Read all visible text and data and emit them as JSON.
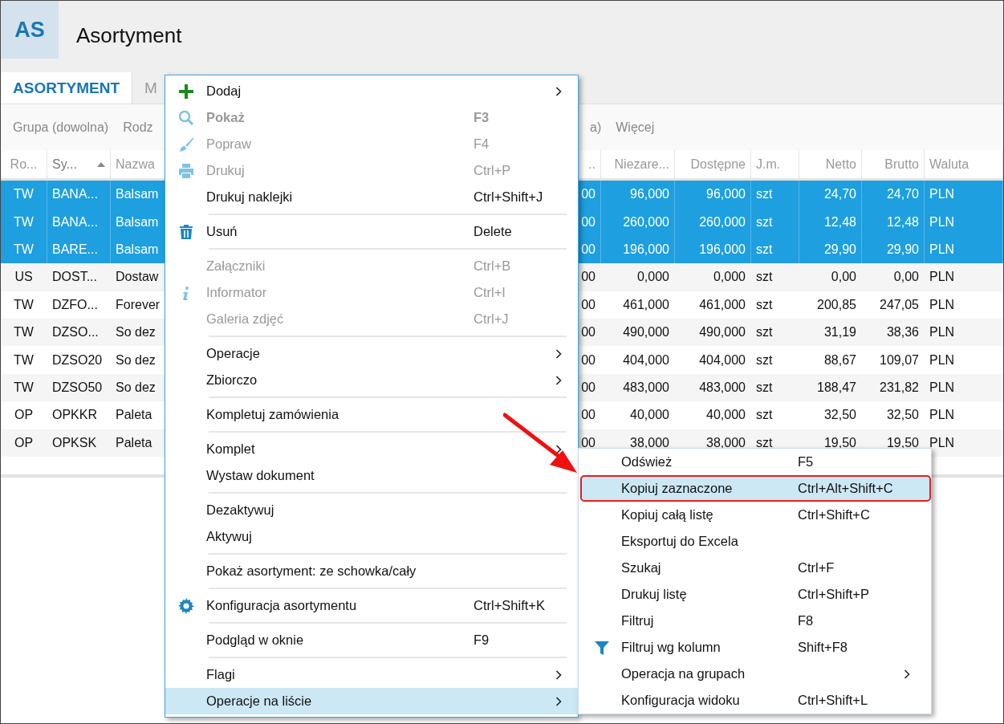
{
  "header": {
    "badge": "AS",
    "title": "Asortyment"
  },
  "tabs": [
    {
      "label": "ASORTYMENT",
      "selected": true
    },
    {
      "label": "M",
      "selected": false
    }
  ],
  "filters": {
    "left": [
      "Grupa (dowolna)",
      "Rodz"
    ],
    "right": [
      "a)",
      "Więcej"
    ]
  },
  "table": {
    "columns": [
      {
        "label": "Ro...",
        "sorted": false
      },
      {
        "label": "Sy...",
        "sorted": true
      },
      {
        "label": "Nazwa",
        "sorted": false
      },
      {
        "label": "..",
        "sorted": false
      },
      {
        "label": "Niezare...",
        "sorted": false
      },
      {
        "label": "Dostępne",
        "sorted": false
      },
      {
        "label": "J.m.",
        "sorted": false
      },
      {
        "label": "Netto",
        "sorted": false
      },
      {
        "label": "Brutto",
        "sorted": false
      },
      {
        "label": "Waluta",
        "sorted": false
      }
    ],
    "rows": [
      {
        "selected": true,
        "cells": [
          "TW",
          "BANA...",
          "Balsam",
          "00",
          "96,000",
          "96,000",
          "szt",
          "24,70",
          "24,70",
          "PLN"
        ]
      },
      {
        "selected": true,
        "cells": [
          "TW",
          "BANA...",
          "Balsam",
          "00",
          "260,000",
          "260,000",
          "szt",
          "12,48",
          "12,48",
          "PLN"
        ]
      },
      {
        "selected": true,
        "cells": [
          "TW",
          "BARE...",
          "Balsam",
          "00",
          "196,000",
          "196,000",
          "szt",
          "29,90",
          "29,90",
          "PLN"
        ]
      },
      {
        "selected": false,
        "cells": [
          "US",
          "DOST...",
          "Dostaw",
          "00",
          "0,000",
          "0,000",
          "szt",
          "0,00",
          "0,00",
          "PLN"
        ]
      },
      {
        "selected": false,
        "cells": [
          "TW",
          "DZFO...",
          "Forever",
          "00",
          "461,000",
          "461,000",
          "szt",
          "200,85",
          "247,05",
          "PLN"
        ]
      },
      {
        "selected": false,
        "cells": [
          "TW",
          "DZSO...",
          "So dez",
          "00",
          "490,000",
          "490,000",
          "szt",
          "31,19",
          "38,36",
          "PLN"
        ]
      },
      {
        "selected": false,
        "cells": [
          "TW",
          "DZSO20",
          "So dez",
          "00",
          "404,000",
          "404,000",
          "szt",
          "88,67",
          "109,07",
          "PLN"
        ]
      },
      {
        "selected": false,
        "cells": [
          "TW",
          "DZSO50",
          "So dez",
          "00",
          "483,000",
          "483,000",
          "szt",
          "188,47",
          "231,82",
          "PLN"
        ]
      },
      {
        "selected": false,
        "cells": [
          "OP",
          "OPKKR",
          "Paleta",
          "00",
          "40,000",
          "40,000",
          "szt",
          "32,50",
          "32,50",
          "PLN"
        ]
      },
      {
        "selected": false,
        "cells": [
          "OP",
          "OPKSK",
          "Paleta",
          "00",
          "38,000",
          "38,000",
          "szt",
          "19,50",
          "19,50",
          "PLN"
        ]
      }
    ]
  },
  "context_menu": {
    "items": [
      {
        "kind": "item",
        "label": "Dodaj",
        "submenu": true,
        "disabled": false,
        "selected": false
      },
      {
        "kind": "item",
        "label": "Pokaż",
        "shortcut": "F3",
        "bold": true,
        "disabled": true,
        "selected": false
      },
      {
        "kind": "item",
        "label": "Popraw",
        "shortcut": "F4",
        "disabled": true,
        "selected": false
      },
      {
        "kind": "item",
        "label": "Drukuj",
        "shortcut": "Ctrl+P",
        "disabled": true,
        "selected": false
      },
      {
        "kind": "item",
        "label": "Drukuj naklejki",
        "shortcut": "Ctrl+Shift+J",
        "disabled": false,
        "selected": false
      },
      {
        "kind": "separator"
      },
      {
        "kind": "item",
        "label": "Usuń",
        "shortcut": "Delete",
        "disabled": false,
        "selected": false
      },
      {
        "kind": "separator"
      },
      {
        "kind": "item",
        "label": "Załączniki",
        "shortcut": "Ctrl+B",
        "disabled": true,
        "selected": false
      },
      {
        "kind": "item",
        "label": "Informator",
        "shortcut": "Ctrl+I",
        "disabled": true,
        "selected": false
      },
      {
        "kind": "item",
        "label": "Galeria zdjęć",
        "shortcut": "Ctrl+J",
        "disabled": true,
        "selected": false
      },
      {
        "kind": "separator"
      },
      {
        "kind": "item",
        "label": "Operacje",
        "submenu": true,
        "disabled": false,
        "selected": false
      },
      {
        "kind": "item",
        "label": "Zbiorczo",
        "submenu": true,
        "disabled": false,
        "selected": false
      },
      {
        "kind": "separator"
      },
      {
        "kind": "item",
        "label": "Kompletuj zamówienia",
        "disabled": false,
        "selected": false
      },
      {
        "kind": "separator"
      },
      {
        "kind": "item",
        "label": "Komplet",
        "submenu": true,
        "disabled": false,
        "selected": false
      },
      {
        "kind": "item",
        "label": "Wystaw dokument",
        "disabled": false,
        "selected": false
      },
      {
        "kind": "separator"
      },
      {
        "kind": "item",
        "label": "Dezaktywuj",
        "disabled": false,
        "selected": false
      },
      {
        "kind": "item",
        "label": "Aktywuj",
        "disabled": false,
        "selected": false
      },
      {
        "kind": "separator"
      },
      {
        "kind": "item",
        "label": "Pokaż asortyment: ze schowka/cały",
        "disabled": false,
        "selected": false
      },
      {
        "kind": "separator"
      },
      {
        "kind": "item",
        "label": "Konfiguracja asortymentu",
        "shortcut": "Ctrl+Shift+K",
        "disabled": false,
        "selected": false
      },
      {
        "kind": "separator"
      },
      {
        "kind": "item",
        "label": "Podgląd w oknie",
        "shortcut": "F9",
        "disabled": false,
        "selected": false
      },
      {
        "kind": "separator"
      },
      {
        "kind": "item",
        "label": "Flagi",
        "submenu": true,
        "disabled": false,
        "selected": false
      },
      {
        "kind": "item",
        "label": "Operacje na liście",
        "submenu": true,
        "disabled": false,
        "selected": true
      }
    ]
  },
  "submenu": {
    "items": [
      {
        "label": "Odśwież",
        "shortcut": "F5",
        "selected": false
      },
      {
        "label": "Kopiuj zaznaczone",
        "shortcut": "Ctrl+Alt+Shift+C",
        "selected": true,
        "annotated": true
      },
      {
        "label": "Kopiuj całą listę",
        "shortcut": "Ctrl+Shift+C",
        "selected": false
      },
      {
        "label": "Eksportuj do Excela",
        "selected": false
      },
      {
        "label": "Szukaj",
        "shortcut": "Ctrl+F",
        "selected": false
      },
      {
        "label": "Drukuj listę",
        "shortcut": "Ctrl+Shift+P",
        "selected": false
      },
      {
        "label": "Filtruj",
        "shortcut": "F8",
        "selected": false
      },
      {
        "label": "Filtruj wg kolumn",
        "shortcut": "Shift+F8",
        "selected": false
      },
      {
        "label": "Operacja na grupach",
        "submenu": true,
        "selected": false
      },
      {
        "label": "Konfiguracja widoku",
        "shortcut": "Ctrl+Shift+L",
        "selected": false
      }
    ]
  }
}
